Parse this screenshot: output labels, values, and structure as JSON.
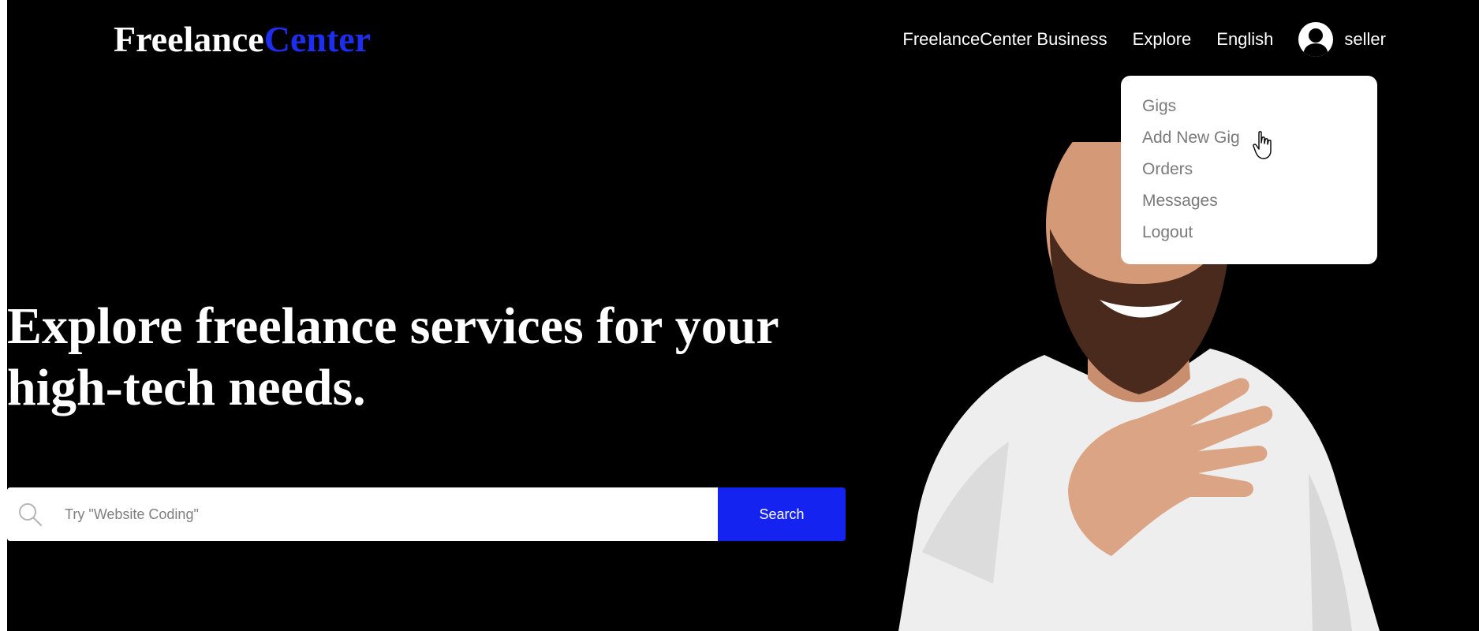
{
  "header": {
    "logo": {
      "part_a": "Freelance",
      "part_b": "Center"
    },
    "nav": [
      {
        "label": "FreelanceCenter Business"
      },
      {
        "label": "Explore"
      },
      {
        "label": "English"
      }
    ],
    "user": {
      "name": "seller",
      "avatar_icon": "user-avatar-icon"
    }
  },
  "dropdown": {
    "items": [
      {
        "label": "Gigs"
      },
      {
        "label": "Add New Gig"
      },
      {
        "label": "Orders"
      },
      {
        "label": "Messages"
      },
      {
        "label": "Logout"
      }
    ]
  },
  "hero": {
    "headline_line1": "Explore freelance services for your",
    "headline_line2": "high-tech needs.",
    "search": {
      "placeholder": "Try \"Website Coding\"",
      "value": "",
      "icon": "search-icon",
      "button_label": "Search"
    },
    "image": "smiling-bearded-man-photo"
  },
  "colors": {
    "background": "#000000",
    "accent": "#1423f0",
    "logo_accent": "#1d2ef0",
    "dropdown_text": "#7a7a7a"
  }
}
